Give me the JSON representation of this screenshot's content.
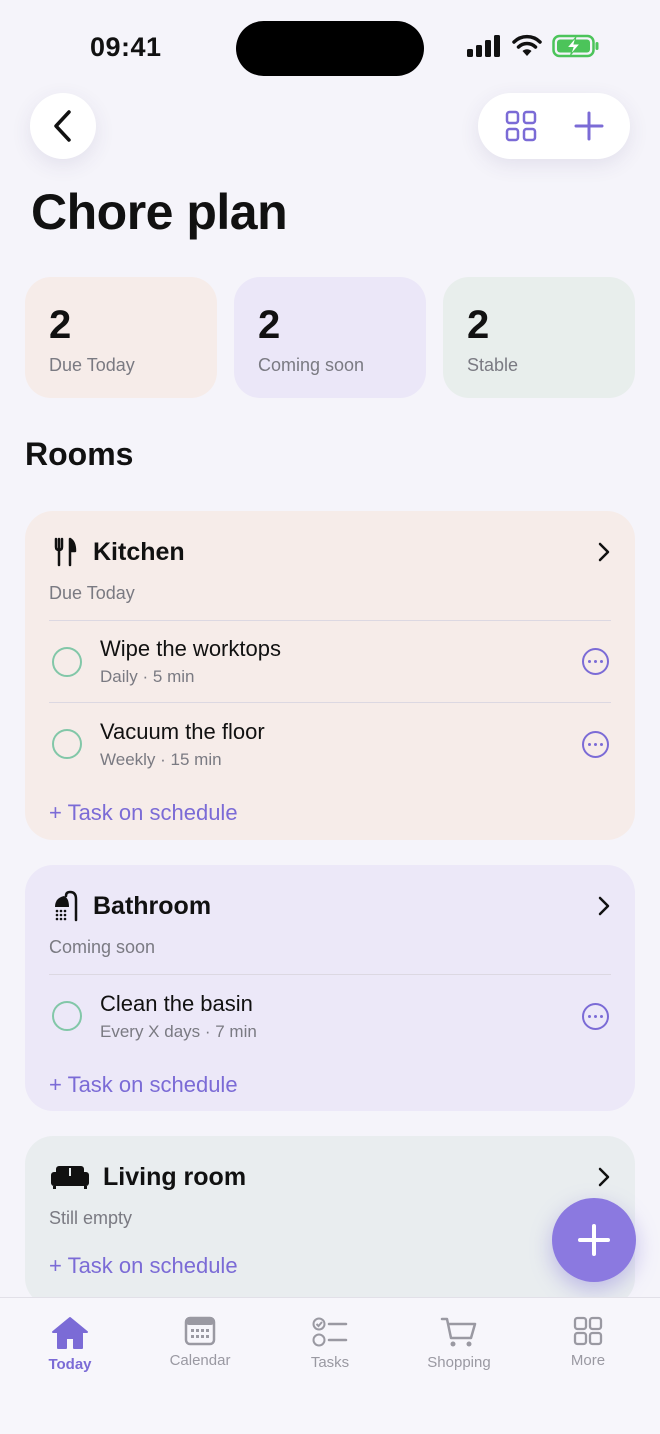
{
  "status_bar": {
    "time": "09:41"
  },
  "header": {
    "title": "Chore plan"
  },
  "stats": [
    {
      "value": "2",
      "label": "Due Today",
      "color": "#f6ece9"
    },
    {
      "value": "2",
      "label": "Coming soon",
      "color": "#ebe7f8"
    },
    {
      "value": "2",
      "label": "Stable",
      "color": "#e8eeec"
    }
  ],
  "rooms_section": {
    "title": "Rooms"
  },
  "rooms": [
    {
      "name": "Kitchen",
      "status": "Due Today",
      "icon": "fork-knife-icon",
      "color": "#f6ece9",
      "tasks": [
        {
          "title": "Wipe the worktops",
          "sub": "Daily · 5 min"
        },
        {
          "title": "Vacuum the floor",
          "sub": "Weekly · 15 min"
        }
      ],
      "add_label": "+ Task on schedule"
    },
    {
      "name": "Bathroom",
      "status": "Coming soon",
      "icon": "shower-icon",
      "color": "#ece8f8",
      "tasks": [
        {
          "title": "Clean the basin",
          "sub": "Every X days · 7 min"
        }
      ],
      "add_label": "+ Task on schedule"
    },
    {
      "name": "Living room",
      "status": "Still empty",
      "icon": "sofa-icon",
      "color": "#e9edef",
      "tasks": [],
      "add_label": "+ Task on schedule"
    }
  ],
  "tab_bar": [
    {
      "label": "Today",
      "icon": "house-icon",
      "active": true
    },
    {
      "label": "Calendar",
      "icon": "calendar-icon"
    },
    {
      "label": "Tasks",
      "icon": "checklist-icon"
    },
    {
      "label": "Shopping",
      "icon": "cart-icon"
    },
    {
      "label": "More",
      "icon": "grid-icon"
    }
  ],
  "colors": {
    "accent": "#7b6bd6",
    "fab": "#8b79e0",
    "check_circle": "#82c7a8"
  }
}
